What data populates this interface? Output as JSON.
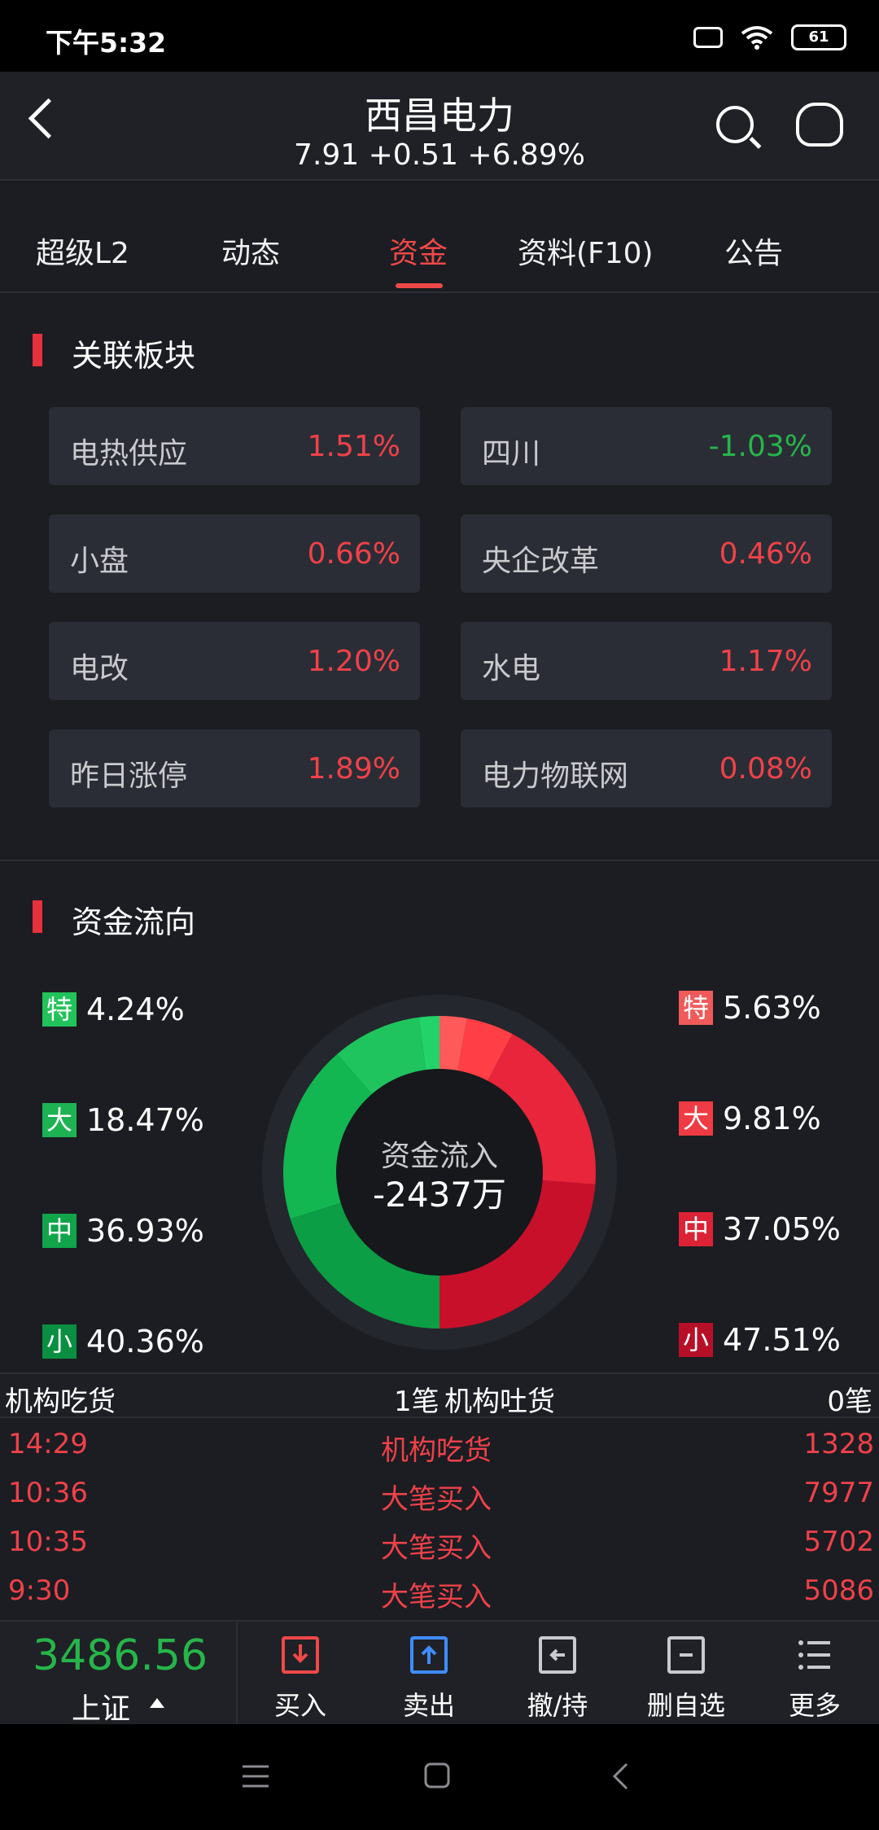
{
  "status": {
    "time": "下午5:32",
    "battery": "61"
  },
  "header": {
    "title": "西昌电力",
    "price": "7.91 +0.51 +6.89%"
  },
  "tabs": [
    {
      "label": "超级L2"
    },
    {
      "label": "动态"
    },
    {
      "label": "资金"
    },
    {
      "label": "资料(F10)"
    },
    {
      "label": "公告"
    }
  ],
  "sectors": {
    "title": "关联板块",
    "items": [
      {
        "name": "电热供应",
        "pct": "1.51%",
        "trend": "up"
      },
      {
        "name": "四川",
        "pct": "-1.03%",
        "trend": "down"
      },
      {
        "name": "小盘",
        "pct": "0.66%",
        "trend": "up"
      },
      {
        "name": "央企改革",
        "pct": "0.46%",
        "trend": "up"
      },
      {
        "name": "电改",
        "pct": "1.20%",
        "trend": "up"
      },
      {
        "name": "水电",
        "pct": "1.17%",
        "trend": "up"
      },
      {
        "name": "昨日涨停",
        "pct": "1.89%",
        "trend": "up"
      },
      {
        "name": "电力物联网",
        "pct": "0.08%",
        "trend": "up"
      }
    ]
  },
  "fund_flow": {
    "title": "资金流向",
    "outflow": [
      {
        "tag": "特",
        "pct": "4.24%",
        "value": 4.24,
        "color": "#22d36a"
      },
      {
        "tag": "大",
        "pct": "18.47%",
        "value": 18.47,
        "color": "#1fc45f"
      },
      {
        "tag": "中",
        "pct": "36.93%",
        "value": 36.93,
        "color": "#12b751"
      },
      {
        "tag": "小",
        "pct": "40.36%",
        "value": 40.36,
        "color": "#0c9e45"
      }
    ],
    "inflow": [
      {
        "tag": "特",
        "pct": "5.63%",
        "value": 5.63,
        "color": "#ff5a5a"
      },
      {
        "tag": "大",
        "pct": "9.81%",
        "value": 9.81,
        "color": "#ff3f45"
      },
      {
        "tag": "中",
        "pct": "37.05%",
        "value": 37.05,
        "color": "#e8253a"
      },
      {
        "tag": "小",
        "pct": "47.51%",
        "value": 47.51,
        "color": "#c8102b"
      }
    ],
    "center_label": "资金流入",
    "center_value": "-2437万"
  },
  "institution": {
    "buy_label": "机构吃货",
    "buy_count": "1笔",
    "sell_label": "机构吐货",
    "sell_count": "0笔"
  },
  "trades": [
    {
      "time": "14:29",
      "type": "机构吃货",
      "volume": "1328"
    },
    {
      "time": "10:36",
      "type": "大笔买入",
      "volume": "7977"
    },
    {
      "time": "10:35",
      "type": "大笔买入",
      "volume": "5702"
    },
    {
      "time": "9:30",
      "type": "大笔买入",
      "volume": "5086"
    }
  ],
  "bottom": {
    "index_value": "3486.56",
    "index_name": "上证",
    "actions": [
      {
        "label": "买入",
        "color": "#f04848"
      },
      {
        "label": "卖出",
        "color": "#3f8cff"
      },
      {
        "label": "撤/持",
        "color": "#c9c9ce"
      },
      {
        "label": "删自选",
        "color": "#c9c9ce"
      },
      {
        "label": "更多",
        "color": "#c9c9ce"
      }
    ]
  }
}
